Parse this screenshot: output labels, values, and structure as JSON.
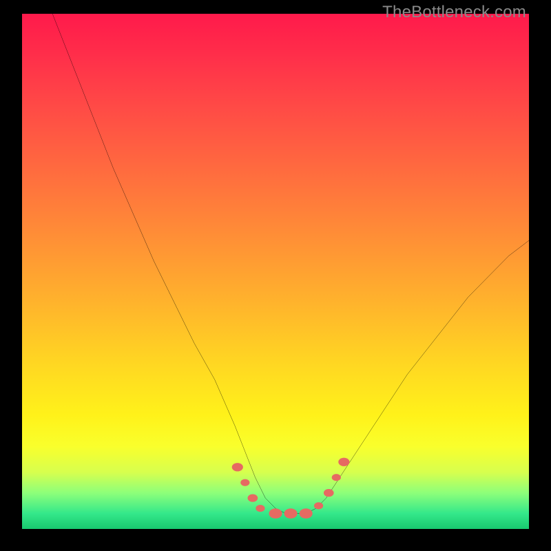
{
  "watermark": "TheBottleneck.com",
  "colors": {
    "frame": "#000000",
    "curve": "#000000",
    "markers": "#e66a62",
    "gradient_top": "#ff1a4b",
    "gradient_bottom": "#18c96f"
  },
  "chart_data": {
    "type": "line",
    "title": "",
    "xlabel": "",
    "ylabel": "",
    "xlim": [
      0,
      100
    ],
    "ylim": [
      0,
      100
    ],
    "grid": false,
    "legend": false,
    "notes": "V-shaped bottleneck curve on a red→green vertical gradient. No axis ticks or labels are rendered in the image; x and y interpreted as 0–100 percent. Lower y = better (green).",
    "series": [
      {
        "name": "bottleneck-curve",
        "x": [
          6,
          10,
          14,
          18,
          22,
          26,
          30,
          34,
          38,
          42,
          44,
          46,
          48,
          50,
          52,
          54,
          56,
          58,
          60,
          64,
          68,
          72,
          76,
          80,
          84,
          88,
          92,
          96,
          100
        ],
        "y": [
          100,
          90,
          80,
          70,
          61,
          52,
          44,
          36,
          29,
          20,
          15,
          10,
          6,
          4,
          3,
          3,
          3,
          4,
          6,
          12,
          18,
          24,
          30,
          35,
          40,
          45,
          49,
          53,
          56
        ]
      }
    ],
    "markers": [
      {
        "x": 42.5,
        "y": 12,
        "r": 1.1
      },
      {
        "x": 44.0,
        "y": 9,
        "r": 0.9
      },
      {
        "x": 45.5,
        "y": 6,
        "r": 1.0
      },
      {
        "x": 47.0,
        "y": 4,
        "r": 0.9
      },
      {
        "x": 50.0,
        "y": 3,
        "r": 1.3
      },
      {
        "x": 53.0,
        "y": 3,
        "r": 1.3
      },
      {
        "x": 56.0,
        "y": 3,
        "r": 1.3
      },
      {
        "x": 58.5,
        "y": 4.5,
        "r": 0.9
      },
      {
        "x": 60.5,
        "y": 7,
        "r": 1.0
      },
      {
        "x": 62.0,
        "y": 10,
        "r": 0.9
      },
      {
        "x": 63.5,
        "y": 13,
        "r": 1.1
      }
    ]
  }
}
